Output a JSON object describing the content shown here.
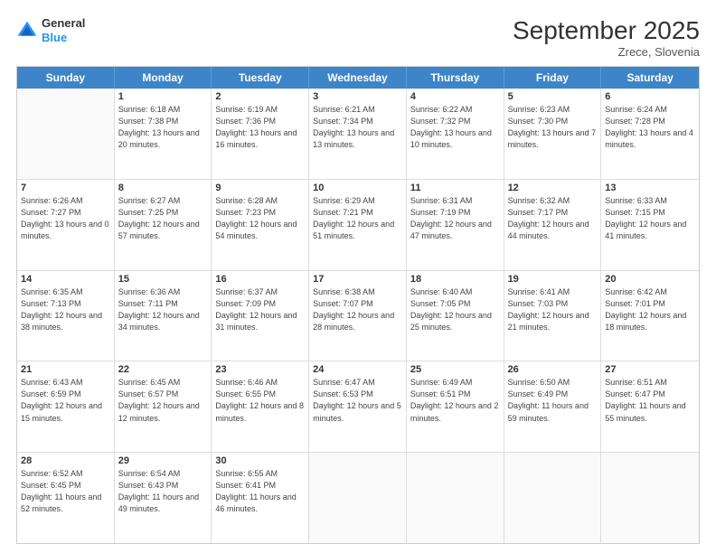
{
  "header": {
    "logo_general": "General",
    "logo_blue": "Blue",
    "title": "September 2025",
    "subtitle": "Zrece, Slovenia"
  },
  "days_of_week": [
    "Sunday",
    "Monday",
    "Tuesday",
    "Wednesday",
    "Thursday",
    "Friday",
    "Saturday"
  ],
  "weeks": [
    [
      {
        "day": null,
        "sunrise": null,
        "sunset": null,
        "daylight": null
      },
      {
        "day": "1",
        "sunrise": "Sunrise: 6:18 AM",
        "sunset": "Sunset: 7:38 PM",
        "daylight": "Daylight: 13 hours and 20 minutes."
      },
      {
        "day": "2",
        "sunrise": "Sunrise: 6:19 AM",
        "sunset": "Sunset: 7:36 PM",
        "daylight": "Daylight: 13 hours and 16 minutes."
      },
      {
        "day": "3",
        "sunrise": "Sunrise: 6:21 AM",
        "sunset": "Sunset: 7:34 PM",
        "daylight": "Daylight: 13 hours and 13 minutes."
      },
      {
        "day": "4",
        "sunrise": "Sunrise: 6:22 AM",
        "sunset": "Sunset: 7:32 PM",
        "daylight": "Daylight: 13 hours and 10 minutes."
      },
      {
        "day": "5",
        "sunrise": "Sunrise: 6:23 AM",
        "sunset": "Sunset: 7:30 PM",
        "daylight": "Daylight: 13 hours and 7 minutes."
      },
      {
        "day": "6",
        "sunrise": "Sunrise: 6:24 AM",
        "sunset": "Sunset: 7:28 PM",
        "daylight": "Daylight: 13 hours and 4 minutes."
      }
    ],
    [
      {
        "day": "7",
        "sunrise": "Sunrise: 6:26 AM",
        "sunset": "Sunset: 7:27 PM",
        "daylight": "Daylight: 13 hours and 0 minutes."
      },
      {
        "day": "8",
        "sunrise": "Sunrise: 6:27 AM",
        "sunset": "Sunset: 7:25 PM",
        "daylight": "Daylight: 12 hours and 57 minutes."
      },
      {
        "day": "9",
        "sunrise": "Sunrise: 6:28 AM",
        "sunset": "Sunset: 7:23 PM",
        "daylight": "Daylight: 12 hours and 54 minutes."
      },
      {
        "day": "10",
        "sunrise": "Sunrise: 6:29 AM",
        "sunset": "Sunset: 7:21 PM",
        "daylight": "Daylight: 12 hours and 51 minutes."
      },
      {
        "day": "11",
        "sunrise": "Sunrise: 6:31 AM",
        "sunset": "Sunset: 7:19 PM",
        "daylight": "Daylight: 12 hours and 47 minutes."
      },
      {
        "day": "12",
        "sunrise": "Sunrise: 6:32 AM",
        "sunset": "Sunset: 7:17 PM",
        "daylight": "Daylight: 12 hours and 44 minutes."
      },
      {
        "day": "13",
        "sunrise": "Sunrise: 6:33 AM",
        "sunset": "Sunset: 7:15 PM",
        "daylight": "Daylight: 12 hours and 41 minutes."
      }
    ],
    [
      {
        "day": "14",
        "sunrise": "Sunrise: 6:35 AM",
        "sunset": "Sunset: 7:13 PM",
        "daylight": "Daylight: 12 hours and 38 minutes."
      },
      {
        "day": "15",
        "sunrise": "Sunrise: 6:36 AM",
        "sunset": "Sunset: 7:11 PM",
        "daylight": "Daylight: 12 hours and 34 minutes."
      },
      {
        "day": "16",
        "sunrise": "Sunrise: 6:37 AM",
        "sunset": "Sunset: 7:09 PM",
        "daylight": "Daylight: 12 hours and 31 minutes."
      },
      {
        "day": "17",
        "sunrise": "Sunrise: 6:38 AM",
        "sunset": "Sunset: 7:07 PM",
        "daylight": "Daylight: 12 hours and 28 minutes."
      },
      {
        "day": "18",
        "sunrise": "Sunrise: 6:40 AM",
        "sunset": "Sunset: 7:05 PM",
        "daylight": "Daylight: 12 hours and 25 minutes."
      },
      {
        "day": "19",
        "sunrise": "Sunrise: 6:41 AM",
        "sunset": "Sunset: 7:03 PM",
        "daylight": "Daylight: 12 hours and 21 minutes."
      },
      {
        "day": "20",
        "sunrise": "Sunrise: 6:42 AM",
        "sunset": "Sunset: 7:01 PM",
        "daylight": "Daylight: 12 hours and 18 minutes."
      }
    ],
    [
      {
        "day": "21",
        "sunrise": "Sunrise: 6:43 AM",
        "sunset": "Sunset: 6:59 PM",
        "daylight": "Daylight: 12 hours and 15 minutes."
      },
      {
        "day": "22",
        "sunrise": "Sunrise: 6:45 AM",
        "sunset": "Sunset: 6:57 PM",
        "daylight": "Daylight: 12 hours and 12 minutes."
      },
      {
        "day": "23",
        "sunrise": "Sunrise: 6:46 AM",
        "sunset": "Sunset: 6:55 PM",
        "daylight": "Daylight: 12 hours and 8 minutes."
      },
      {
        "day": "24",
        "sunrise": "Sunrise: 6:47 AM",
        "sunset": "Sunset: 6:53 PM",
        "daylight": "Daylight: 12 hours and 5 minutes."
      },
      {
        "day": "25",
        "sunrise": "Sunrise: 6:49 AM",
        "sunset": "Sunset: 6:51 PM",
        "daylight": "Daylight: 12 hours and 2 minutes."
      },
      {
        "day": "26",
        "sunrise": "Sunrise: 6:50 AM",
        "sunset": "Sunset: 6:49 PM",
        "daylight": "Daylight: 11 hours and 59 minutes."
      },
      {
        "day": "27",
        "sunrise": "Sunrise: 6:51 AM",
        "sunset": "Sunset: 6:47 PM",
        "daylight": "Daylight: 11 hours and 55 minutes."
      }
    ],
    [
      {
        "day": "28",
        "sunrise": "Sunrise: 6:52 AM",
        "sunset": "Sunset: 6:45 PM",
        "daylight": "Daylight: 11 hours and 52 minutes."
      },
      {
        "day": "29",
        "sunrise": "Sunrise: 6:54 AM",
        "sunset": "Sunset: 6:43 PM",
        "daylight": "Daylight: 11 hours and 49 minutes."
      },
      {
        "day": "30",
        "sunrise": "Sunrise: 6:55 AM",
        "sunset": "Sunset: 6:41 PM",
        "daylight": "Daylight: 11 hours and 46 minutes."
      },
      {
        "day": null,
        "sunrise": null,
        "sunset": null,
        "daylight": null
      },
      {
        "day": null,
        "sunrise": null,
        "sunset": null,
        "daylight": null
      },
      {
        "day": null,
        "sunrise": null,
        "sunset": null,
        "daylight": null
      },
      {
        "day": null,
        "sunrise": null,
        "sunset": null,
        "daylight": null
      }
    ]
  ]
}
